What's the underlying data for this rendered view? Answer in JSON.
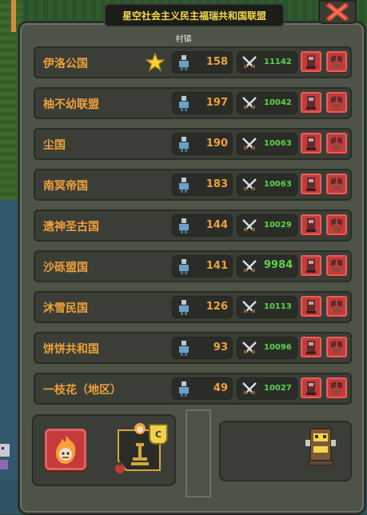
{
  "window": {
    "title": "星空社会主义民主福瑞共和国联盟",
    "section_label": "村镇"
  },
  "colors": {
    "name": "#f0a03a",
    "power": "#5cd34d",
    "button": "#c63a3a",
    "title": "#f3d64a"
  },
  "rows": [
    {
      "name": "伊洛公国",
      "favorite": true,
      "population": "158",
      "power": "11142",
      "big": false
    },
    {
      "name": "柚不幼联盟",
      "favorite": false,
      "population": "197",
      "power": "10042",
      "big": false
    },
    {
      "name": "尘国",
      "favorite": false,
      "population": "190",
      "power": "10063",
      "big": false
    },
    {
      "name": "南冥帝国",
      "favorite": false,
      "population": "183",
      "power": "10063",
      "big": false
    },
    {
      "name": "遗神圣古国",
      "favorite": false,
      "population": "144",
      "power": "10029",
      "big": false
    },
    {
      "name": "沙砾盟国",
      "favorite": false,
      "population": "141",
      "power": "9984",
      "big": true
    },
    {
      "name": "沐雪民国",
      "favorite": false,
      "population": "126",
      "power": "10113",
      "big": false
    },
    {
      "name": "饼饼共和国",
      "favorite": false,
      "population": "93",
      "power": "10096",
      "big": false
    },
    {
      "name": "一枝花（地区）",
      "favorite": false,
      "population": "49",
      "power": "10027",
      "big": false
    }
  ],
  "icons": {
    "population": "citizen-icon",
    "power": "crossed-swords-icon",
    "action1": "inspect-unit-icon",
    "action2": "war-declaration-icon",
    "favorite": "star-icon",
    "close": "close-icon",
    "flame": "flame-emblem-icon",
    "king": "king-icon",
    "badge": "crest-badge-icon",
    "tower": "totem-tower-icon"
  },
  "bottom": {
    "badge_letter": "C"
  }
}
